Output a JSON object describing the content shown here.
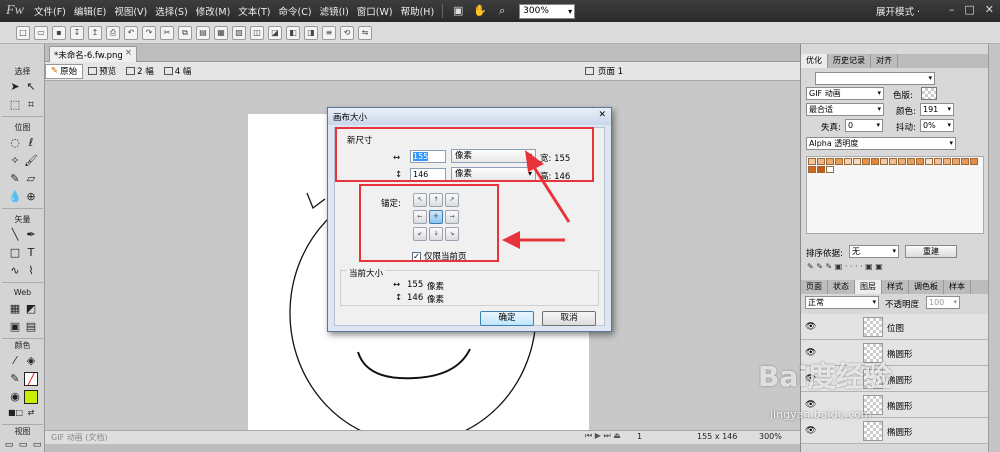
{
  "app": {
    "logo": "Fw",
    "menus": [
      "文件(F)",
      "编辑(E)",
      "视图(V)",
      "选择(S)",
      "修改(M)",
      "文本(T)",
      "命令(C)",
      "滤镜(I)",
      "窗口(W)",
      "帮助(H)"
    ],
    "zoom": "300%",
    "workspace": "展开模式 ·",
    "window_controls": [
      "–",
      "□",
      "✕"
    ]
  },
  "tools": {
    "select": "选择",
    "bitmap": "位图",
    "vector": "矢量",
    "web": "Web",
    "colors": "颜色",
    "view": "视图"
  },
  "document": {
    "tab_name": "*未命名-6.fw.png",
    "tab_close": "×",
    "views": [
      "原始",
      "预览",
      "2 幅",
      "4 幅"
    ],
    "page_label": "页面 1",
    "status_left": "GIF 动画 (文档)",
    "frame": "1",
    "size": "155 x 146",
    "zoom": "300%"
  },
  "dialog": {
    "title": "画布大小",
    "close": "✕",
    "new_size_label": "新尺寸",
    "width_value": "155",
    "height_value": "146",
    "width_unit": "像素",
    "height_unit": "像素",
    "width_caption": "宽: 155",
    "height_caption": "高: 146",
    "anchor_label": "锚定:",
    "current_page_only": "仅限当前页",
    "current_size_label": "当前大小",
    "current_width": "155",
    "current_height": "146",
    "current_unit_w": "像素",
    "current_unit_h": "像素",
    "ok": "确定",
    "cancel": "取消"
  },
  "optimize_panel": {
    "tabs": [
      "优化",
      "历史记录",
      "对齐"
    ],
    "format": "GIF 动画",
    "matte_label": "色版:",
    "palette": "最合适",
    "colors_label": "颜色:",
    "colors_value": "191",
    "loss_label": "失真:",
    "loss_value": "0",
    "dither_label": "抖动:",
    "dither_value": "0%",
    "transparency": "Alpha 透明度",
    "sort_label": "排序依据:",
    "sort_value": "无",
    "rebuild": "重建"
  },
  "layers_panel": {
    "tabs": [
      "页面",
      "状态",
      "图层",
      "样式",
      "调色板",
      "样本"
    ],
    "blend_mode": "正常",
    "opacity_label": "不透明度",
    "opacity_value": "100",
    "layers": [
      "位图",
      "椭圆形",
      "椭圆形",
      "椭圆形",
      "椭圆形"
    ]
  },
  "watermark": {
    "main": "Bai度经验",
    "sub": "jingyan.baidu.com"
  },
  "colors": {
    "stroke": "#111111",
    "fill": "#c6f000",
    "annotation": "#e8333a",
    "palette_swatch": "#f2c7a0",
    "palette_dark": "#d2691e"
  }
}
